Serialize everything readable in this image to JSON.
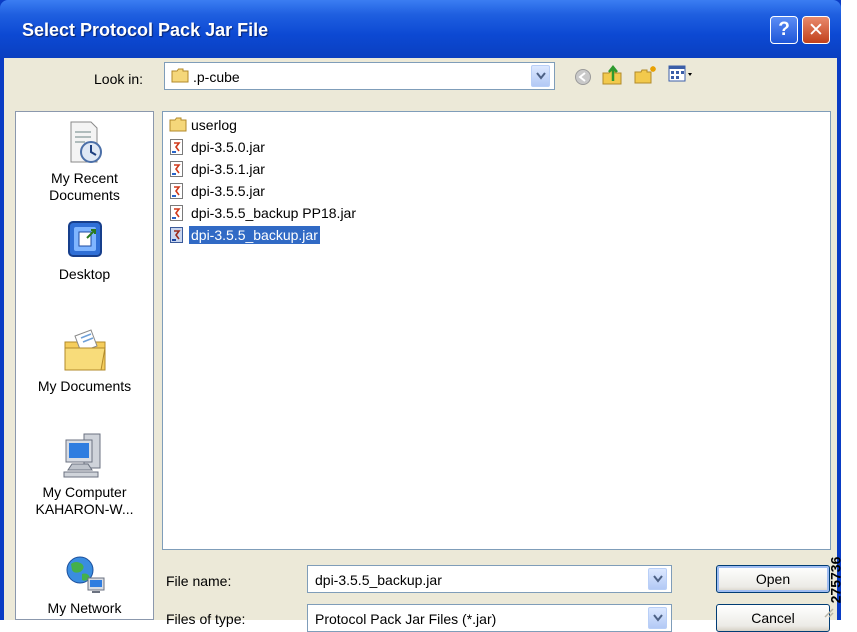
{
  "window": {
    "title": "Select Protocol Pack Jar File",
    "help_glyph": "?",
    "close_glyph": "✕"
  },
  "look_in": {
    "label": "Look in:",
    "value": ".p-cube"
  },
  "toolbar": {
    "icons": [
      "back-icon",
      "up-folder-icon",
      "new-folder-icon",
      "views-menu-icon"
    ]
  },
  "places": [
    {
      "label": "My Recent Documents",
      "icon": "recent-documents-icon"
    },
    {
      "label": "Desktop",
      "icon": "desktop-icon"
    },
    {
      "label": "My Documents",
      "icon": "my-documents-icon"
    },
    {
      "label": "My Computer KAHARON-W...",
      "icon": "my-computer-icon"
    },
    {
      "label": "My Network",
      "icon": "my-network-icon"
    }
  ],
  "files": [
    {
      "name": "userlog",
      "type": "folder"
    },
    {
      "name": "dpi-3.5.0.jar",
      "type": "jar"
    },
    {
      "name": "dpi-3.5.1.jar",
      "type": "jar"
    },
    {
      "name": "dpi-3.5.5.jar",
      "type": "jar"
    },
    {
      "name": "dpi-3.5.5_backup PP18.jar",
      "type": "jar"
    },
    {
      "name": "dpi-3.5.5_backup.jar",
      "type": "jar",
      "selected": true
    }
  ],
  "file_name": {
    "label": "File name:",
    "value": "dpi-3.5.5_backup.jar"
  },
  "file_type": {
    "label": "Files of type:",
    "value": "Protocol Pack Jar Files (*.jar)"
  },
  "buttons": {
    "open": "Open",
    "cancel": "Cancel"
  },
  "watermark": "275736",
  "colors": {
    "title_bar": "#0c49d3",
    "dialog_bg": "#ece9d8",
    "selection": "#316ac5"
  }
}
